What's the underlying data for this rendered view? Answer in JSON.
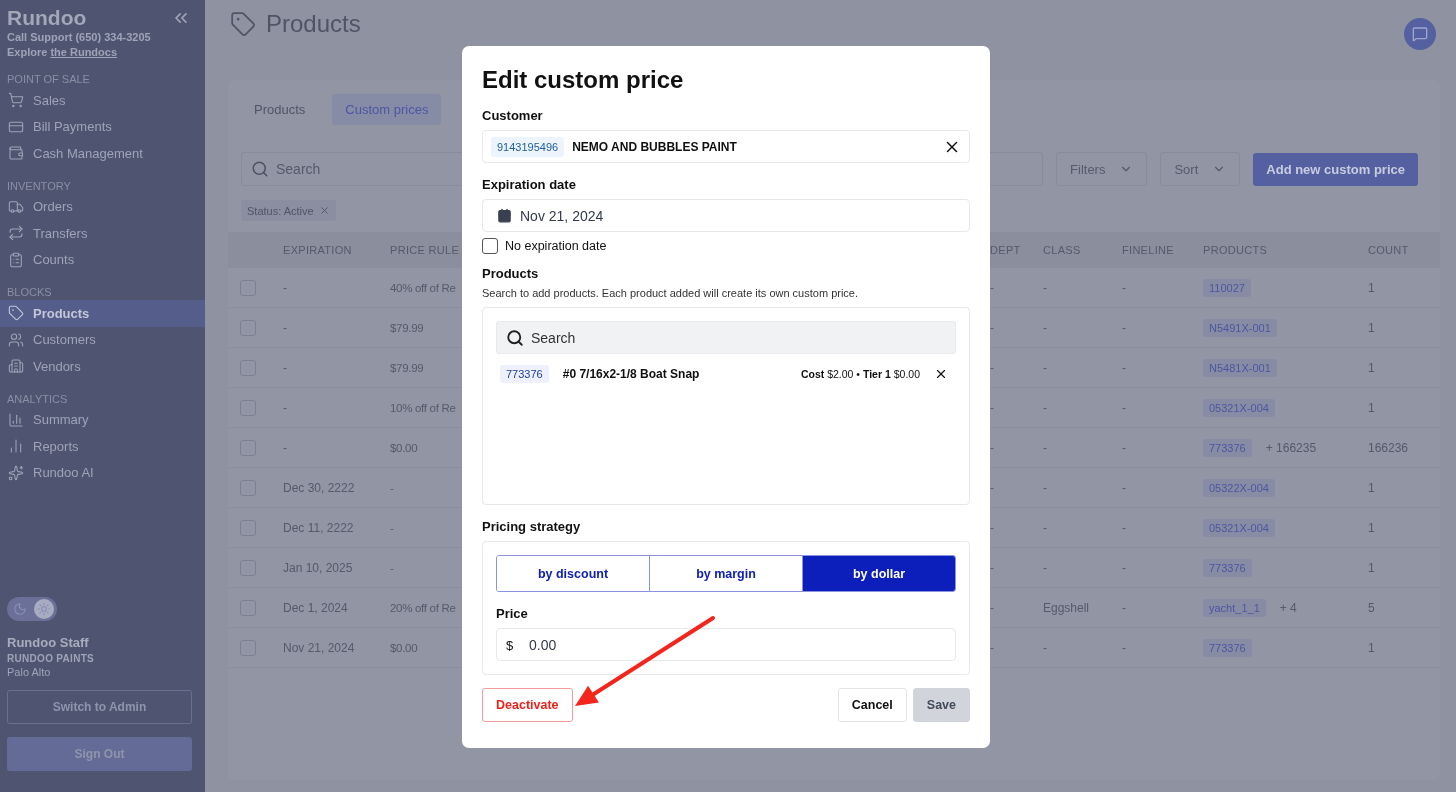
{
  "sidebar": {
    "brand": "Rundoo",
    "support": "Call Support (650) 334-3205",
    "explore": "Explore",
    "explore_link": "the Rundocs",
    "sections": [
      {
        "title": "POINT OF SALE",
        "items": [
          {
            "label": "Sales",
            "selected": false
          },
          {
            "label": "Bill Payments",
            "selected": false
          },
          {
            "label": "Cash Management",
            "selected": false
          }
        ]
      },
      {
        "title": "INVENTORY",
        "items": [
          {
            "label": "Orders",
            "selected": false
          },
          {
            "label": "Transfers",
            "selected": false
          },
          {
            "label": "Counts",
            "selected": false
          }
        ]
      },
      {
        "title": "BLOCKS",
        "items": [
          {
            "label": "Products",
            "selected": true
          },
          {
            "label": "Customers",
            "selected": false
          },
          {
            "label": "Vendors",
            "selected": false
          }
        ]
      },
      {
        "title": "ANALYTICS",
        "items": [
          {
            "label": "Summary",
            "selected": false
          },
          {
            "label": "Reports",
            "selected": false
          },
          {
            "label": "Rundoo AI",
            "selected": false
          }
        ]
      }
    ],
    "light_mode": true,
    "user": {
      "name": "Rundoo Staff",
      "company": "RUNDOO PAINTS",
      "location": "Palo Alto"
    },
    "buttons": [
      "Switch to Admin",
      "Sign Out"
    ]
  },
  "page": {
    "title": "Products",
    "tabs": [
      {
        "label": "Products",
        "selected": false
      },
      {
        "label": "Custom prices",
        "selected": true
      }
    ],
    "search": {
      "placeholder": "Search"
    },
    "filters": "Filters",
    "sort": "Sort",
    "add_button": "Add new custom price",
    "chips": [
      "Status: Active"
    ],
    "table": {
      "columns": [
        "EXPIRATION",
        "PRICE RULE",
        "DEPT",
        "CLASS",
        "FINELINE",
        "PRODUCTS",
        "COUNT"
      ],
      "rows": [
        {
          "checked": false,
          "cells": [
            "-",
            "40% off of Re",
            "-",
            "-",
            "-"
          ],
          "product": "110027",
          "count": "1"
        },
        {
          "checked": false,
          "cells": [
            "-",
            "$79.99",
            "-",
            "-",
            "-"
          ],
          "product": "N5491X-001",
          "count": "1"
        },
        {
          "checked": false,
          "cells": [
            "-",
            "$79.99",
            "-",
            "-",
            "-"
          ],
          "product": "N5481X-001",
          "count": "1"
        },
        {
          "checked": false,
          "cells": [
            "-",
            "10% off of Re",
            "-",
            "-",
            "-"
          ],
          "product": "05321X-004",
          "count": "1"
        },
        {
          "checked": false,
          "cells": [
            "-",
            "$0.00",
            "-",
            "-",
            "-"
          ],
          "product": "773376",
          "more": "+ 166235",
          "count": "166236"
        },
        {
          "checked": false,
          "cells": [
            "Dec 30, 2222",
            "-",
            "-",
            "-",
            "-"
          ],
          "product": "05322X-004",
          "count": "1"
        },
        {
          "checked": false,
          "cells": [
            "Dec 11, 2222",
            "-",
            "-",
            "-",
            "-"
          ],
          "product": "05321X-004",
          "count": "1"
        },
        {
          "checked": false,
          "cells": [
            "Jan 10, 2025",
            "-",
            "-",
            "-",
            "-"
          ],
          "product": "773376",
          "count": "1"
        },
        {
          "checked": false,
          "cells": [
            "Dec 1, 2024",
            "20% off of Re",
            "-",
            "Eggshell",
            "-"
          ],
          "product": "yacht_1_1",
          "more": "+ 4",
          "count": "5"
        },
        {
          "checked": false,
          "cells": [
            "Nov 21, 2024",
            "$0.00",
            "-",
            "-",
            "-"
          ],
          "product": "773376",
          "count": "1"
        }
      ]
    }
  },
  "modal": {
    "title": "Edit custom price",
    "customer": {
      "label": "Customer",
      "id": "9143195496",
      "name": "NEMO AND BUBBLES PAINT"
    },
    "expiration": {
      "label": "Expiration date",
      "value": "Nov 21, 2024"
    },
    "no_expiration": {
      "label": "No expiration date",
      "checked": false
    },
    "products": {
      "label": "Products",
      "help": "Search to add products. Each product added will create its own custom price.",
      "search_placeholder": "Search",
      "items": [
        {
          "sku": "773376",
          "name": "#0 7/16x2-1/8 Boat Snap",
          "pricing": "**Cost** $2.00 • **Tier 1** $0.00"
        }
      ]
    },
    "pricing_strategy": {
      "label": "Pricing strategy",
      "options": [
        {
          "label": "by discount",
          "selected": false
        },
        {
          "label": "by margin",
          "selected": false
        },
        {
          "label": "by dollar",
          "selected": true
        }
      ]
    },
    "price": {
      "label": "Price",
      "prefix": "$",
      "value": "0.00"
    },
    "deactivate": "Deactivate",
    "cancel": "Cancel",
    "save": "Save"
  }
}
